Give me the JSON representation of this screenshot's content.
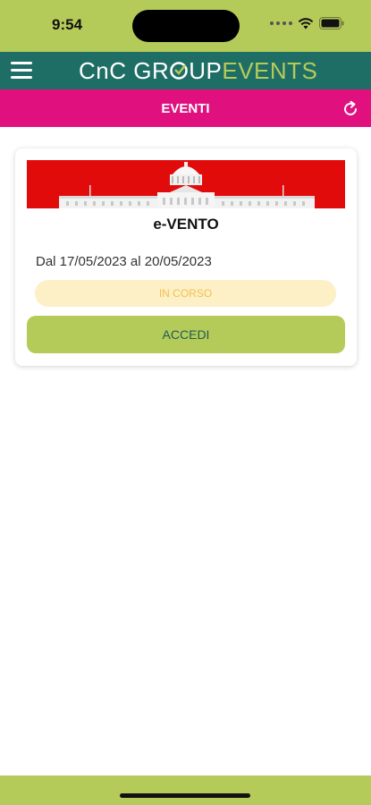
{
  "status_bar": {
    "time": "9:54",
    "icons": [
      "signal-dots-icon",
      "wifi-icon",
      "battery-icon"
    ]
  },
  "header": {
    "logo_part1": "CnC GR",
    "logo_part2": "UP",
    "logo_part3": "EVENTS",
    "menu_icon": "hamburger-menu-icon",
    "colors": {
      "header_bg": "#1f6e66",
      "accent_green": "#b5cb59"
    }
  },
  "title_bar": {
    "title": "EVENTI",
    "refresh_icon": "refresh-icon",
    "color": "#e0117f"
  },
  "events": [
    {
      "name": "e-VENTO",
      "dates": "Dal 17/05/2023 al 20/05/2023",
      "status": "IN CORSO",
      "action_label": "ACCEDI",
      "image": "capitol-building-red-banner"
    }
  ]
}
